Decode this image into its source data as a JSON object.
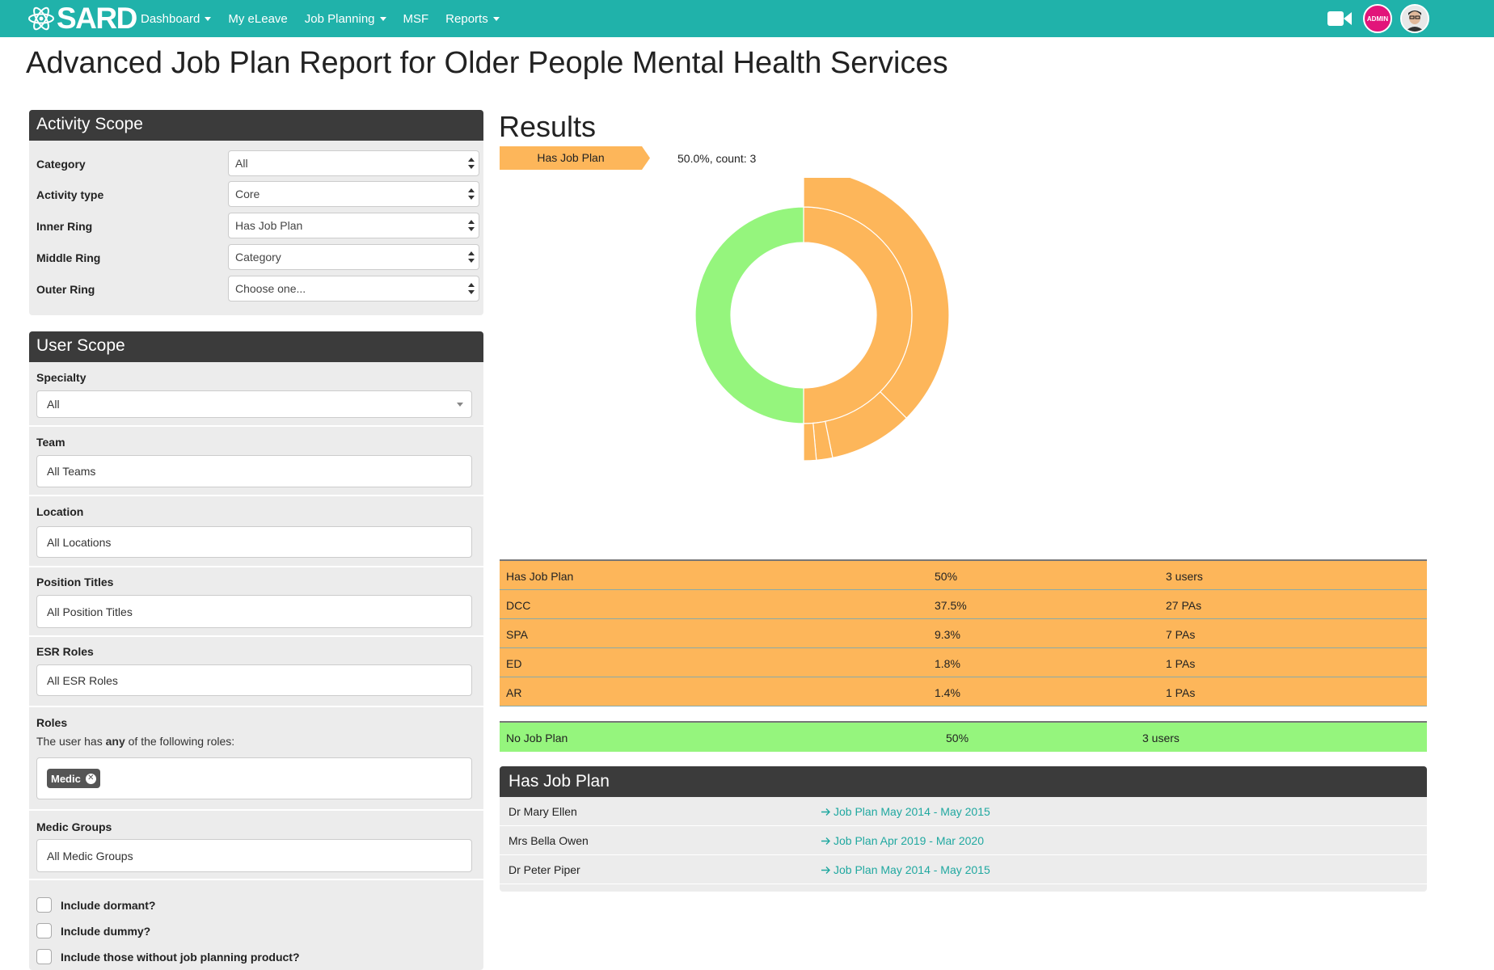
{
  "navbar": {
    "logo_text": "SARD",
    "items": [
      {
        "label": "Dashboard",
        "dropdown": true
      },
      {
        "label": "My eLeave",
        "dropdown": false
      },
      {
        "label": "Job Planning",
        "dropdown": true
      },
      {
        "label": "MSF",
        "dropdown": false
      },
      {
        "label": "Reports",
        "dropdown": true
      }
    ],
    "admin_badge": "ADMIN",
    "brand_color": "#20b2aa",
    "admin_color": "#e2157a"
  },
  "page_title": "Advanced Job Plan Report for Older People Mental Health Services",
  "activity_scope": {
    "title": "Activity Scope",
    "fields": [
      {
        "label": "Category",
        "value": "All"
      },
      {
        "label": "Activity type",
        "value": "Core"
      },
      {
        "label": "Inner Ring",
        "value": "Has Job Plan"
      },
      {
        "label": "Middle Ring",
        "value": "Category"
      },
      {
        "label": "Outer Ring",
        "value": "Choose one..."
      }
    ]
  },
  "user_scope": {
    "title": "User Scope",
    "specialty": {
      "label": "Specialty",
      "value": "All"
    },
    "team": {
      "label": "Team",
      "value": "All Teams"
    },
    "location": {
      "label": "Location",
      "value": "All Locations"
    },
    "position_titles": {
      "label": "Position Titles",
      "value": "All Position Titles"
    },
    "esr_roles": {
      "label": "ESR Roles",
      "value": "All ESR Roles"
    },
    "roles": {
      "label": "Roles",
      "desc_prefix": "The user has ",
      "desc_bold": "any",
      "desc_suffix": " of the following roles:",
      "tags": [
        "Medic"
      ]
    },
    "medic_groups": {
      "label": "Medic Groups",
      "value": "All Medic Groups"
    },
    "checkboxes": [
      {
        "label": "Include dormant?",
        "checked": false
      },
      {
        "label": "Include dummy?",
        "checked": false
      },
      {
        "label": "Include those without job planning product?",
        "checked": false
      }
    ]
  },
  "results": {
    "title": "Results",
    "breadcrumb": "Has Job Plan",
    "breadcrumb_stats": "50.0%, count: 3",
    "orange_rows": [
      {
        "name": "Has Job Plan",
        "percent": "50%",
        "count": "3 users"
      },
      {
        "name": "DCC",
        "percent": "37.5%",
        "count": "27 PAs"
      },
      {
        "name": "SPA",
        "percent": "9.3%",
        "count": "7 PAs"
      },
      {
        "name": "ED",
        "percent": "1.8%",
        "count": "1 PAs"
      },
      {
        "name": "AR",
        "percent": "1.4%",
        "count": "1 PAs"
      }
    ],
    "green_row": {
      "name": "No Job Plan",
      "percent": "50%",
      "count": "3 users"
    },
    "colors": {
      "has_job_plan": "#fdb65a",
      "no_job_plan": "#95f57d"
    }
  },
  "chart_data": {
    "type": "sunburst",
    "inner_ring": [
      {
        "name": "Has Job Plan",
        "percent": 50,
        "count": 3
      },
      {
        "name": "No Job Plan",
        "percent": 50,
        "count": 3
      }
    ],
    "middle_ring": [
      {
        "parent": "Has Job Plan",
        "name": "DCC",
        "percent": 37.5,
        "pas": 27
      },
      {
        "parent": "Has Job Plan",
        "name": "SPA",
        "percent": 9.3,
        "pas": 7
      },
      {
        "parent": "Has Job Plan",
        "name": "ED",
        "percent": 1.8,
        "pas": 1
      },
      {
        "parent": "Has Job Plan",
        "name": "AR",
        "percent": 1.4,
        "pas": 1
      }
    ]
  },
  "has_job_plan_list": {
    "title": "Has Job Plan",
    "rows": [
      {
        "name": "Dr Mary Ellen",
        "link": "Job Plan May 2014 - May 2015"
      },
      {
        "name": "Mrs Bella Owen",
        "link": "Job Plan Apr 2019 - Mar 2020"
      },
      {
        "name": "Dr Peter Piper",
        "link": "Job Plan May 2014 - May 2015"
      }
    ]
  }
}
